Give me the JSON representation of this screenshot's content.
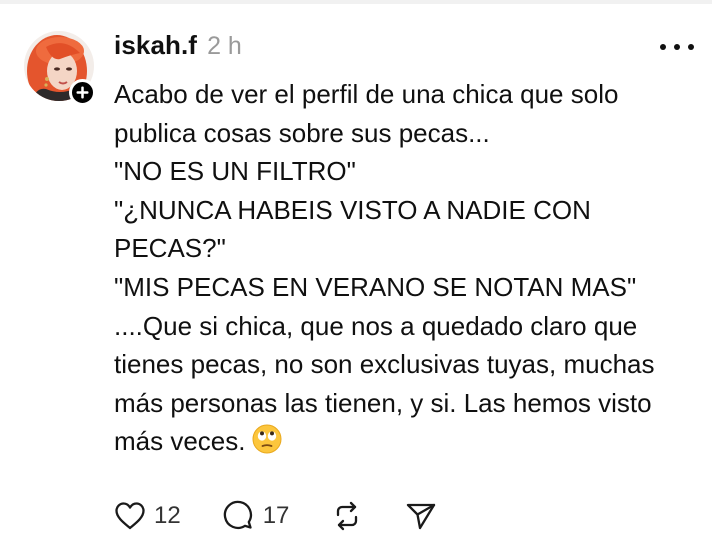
{
  "post": {
    "username": "iskah.f",
    "time": "2 h",
    "body_lines": [
      "Acabo de ver el perfil de una chica que solo",
      "publica cosas sobre sus pecas...",
      "\"NO ES UN FILTRO\"",
      "\"¿NUNCA HABEIS VISTO A NADIE CON",
      "PECAS?\"",
      "\"MIS PECAS EN VERANO SE NOTAN MAS\"",
      "....Que si chica, que nos a quedado claro que",
      "tienes pecas, no son exclusivas tuyas, muchas",
      "más personas las tienen, y si. Las hemos visto",
      "más veces."
    ],
    "emoji": "face-with-rolling-eyes-emoji"
  },
  "actions": {
    "like_count": "12",
    "comment_count": "17"
  },
  "icons": {
    "like": "heart-icon",
    "comment": "comment-bubble-icon",
    "repost": "repost-icon",
    "share": "send-icon",
    "more": "more-horizontal-icon",
    "follow": "plus-icon"
  },
  "colors": {
    "text": "#101010",
    "secondary": "#9a9a9a",
    "background": "#ffffff",
    "avatar_hair": "#e8623a"
  }
}
